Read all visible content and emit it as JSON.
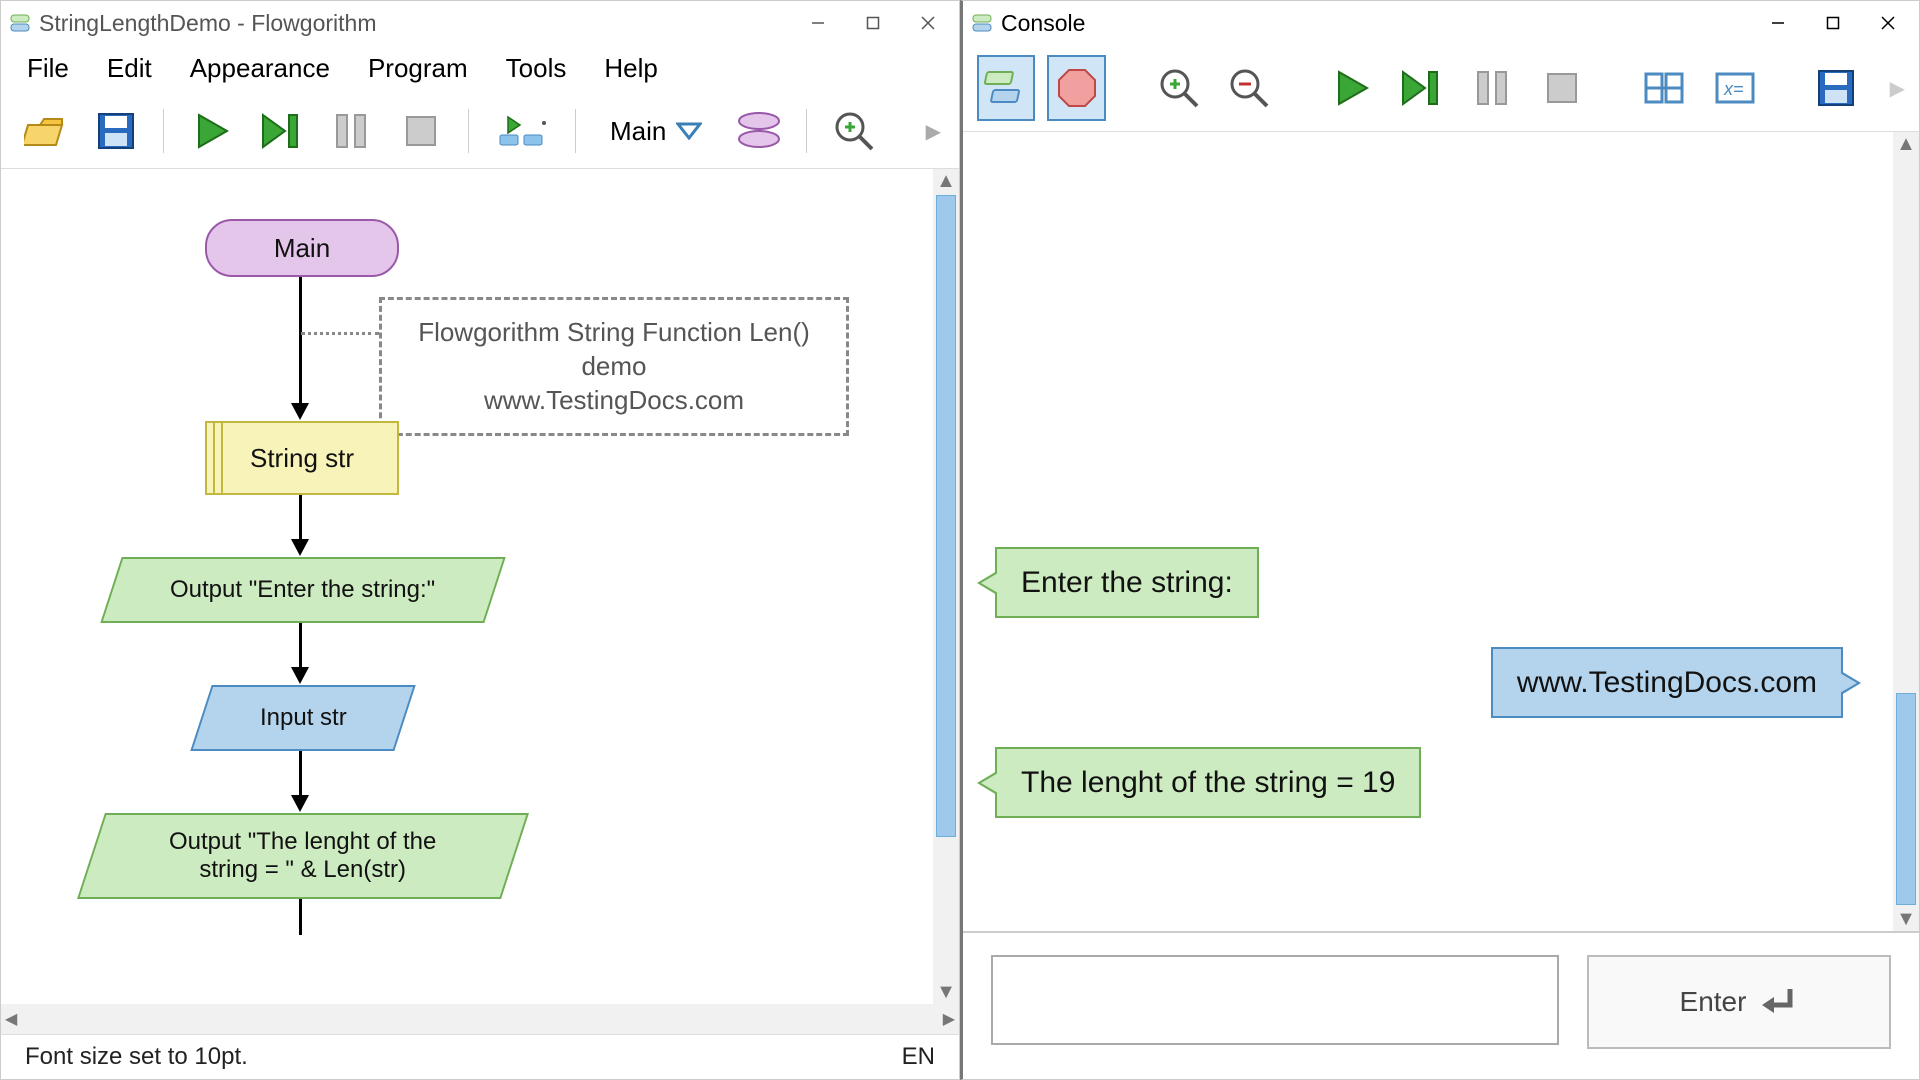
{
  "left_window": {
    "title": "StringLengthDemo - Flowgorithm",
    "menubar": [
      "File",
      "Edit",
      "Appearance",
      "Program",
      "Tools",
      "Help"
    ],
    "function_selector": "Main",
    "statusbar": {
      "message": "Font size set to 10pt.",
      "lang": "EN"
    },
    "flowchart": {
      "start": "Main",
      "comment_line1": "Flowgorithm String Function Len()",
      "comment_line2": "demo",
      "comment_line3": "www.TestingDocs.com",
      "declare": "String str",
      "output1": "Output \"Enter the string:\"",
      "input1": "Input str",
      "output2_line1": "Output \"The lenght of the",
      "output2_line2": "string = \" & Len(str)"
    }
  },
  "right_window": {
    "title": "Console",
    "messages": {
      "prompt1": "Enter the string:",
      "user_input": "www.TestingDocs.com",
      "prompt2": "The lenght of the string = 19"
    },
    "input_value": "",
    "enter_label": "Enter"
  }
}
